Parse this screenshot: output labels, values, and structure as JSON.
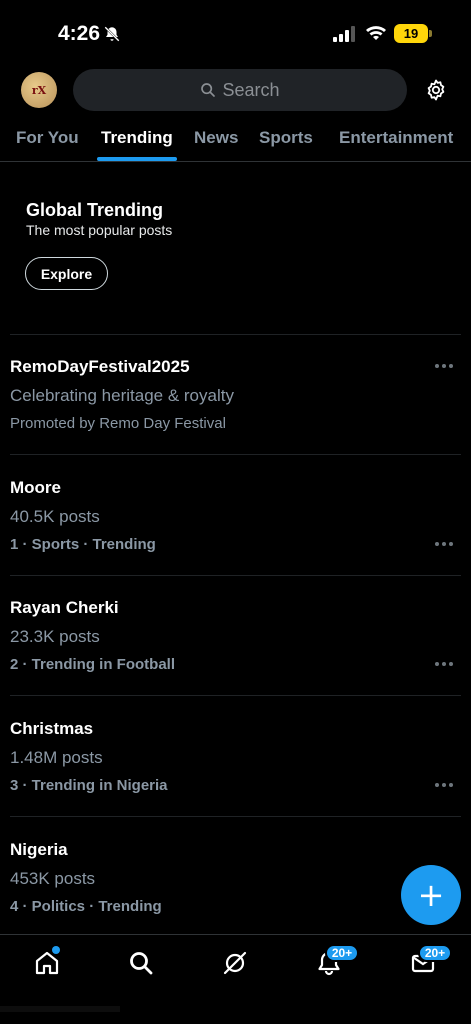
{
  "status_bar": {
    "time": "4:26",
    "battery": "19"
  },
  "header": {
    "avatar_text": "rX",
    "search_placeholder": "Search"
  },
  "tabs": [
    {
      "label": "For You"
    },
    {
      "label": "Trending"
    },
    {
      "label": "News"
    },
    {
      "label": "Sports"
    },
    {
      "label": "Entertainment"
    }
  ],
  "global_trending": {
    "title": "Global Trending",
    "subtitle": "The most popular posts",
    "button": "Explore"
  },
  "trends": [
    {
      "name": "RemoDayFestival2025",
      "count": "Celebrating heritage & royalty",
      "meta": "Promoted by Remo Day Festival"
    },
    {
      "name": "Moore",
      "count": "40.5K posts",
      "meta": "1 · Sports · Trending"
    },
    {
      "name": "Rayan Cherki",
      "count": "23.3K posts",
      "meta": "2 · Trending in Football"
    },
    {
      "name": "Christmas",
      "count": "1.48M posts",
      "meta": "3 · Trending in Nigeria"
    },
    {
      "name": "Nigeria",
      "count": "453K posts",
      "meta": "4 · Politics · Trending"
    }
  ],
  "fab": {
    "label": "+"
  },
  "bottom_nav": {
    "notifications_badge": "20+",
    "messages_badge": "20+"
  },
  "colors": {
    "accent": "#1d9bf0",
    "background": "#000000",
    "muted": "#8b98a5"
  }
}
